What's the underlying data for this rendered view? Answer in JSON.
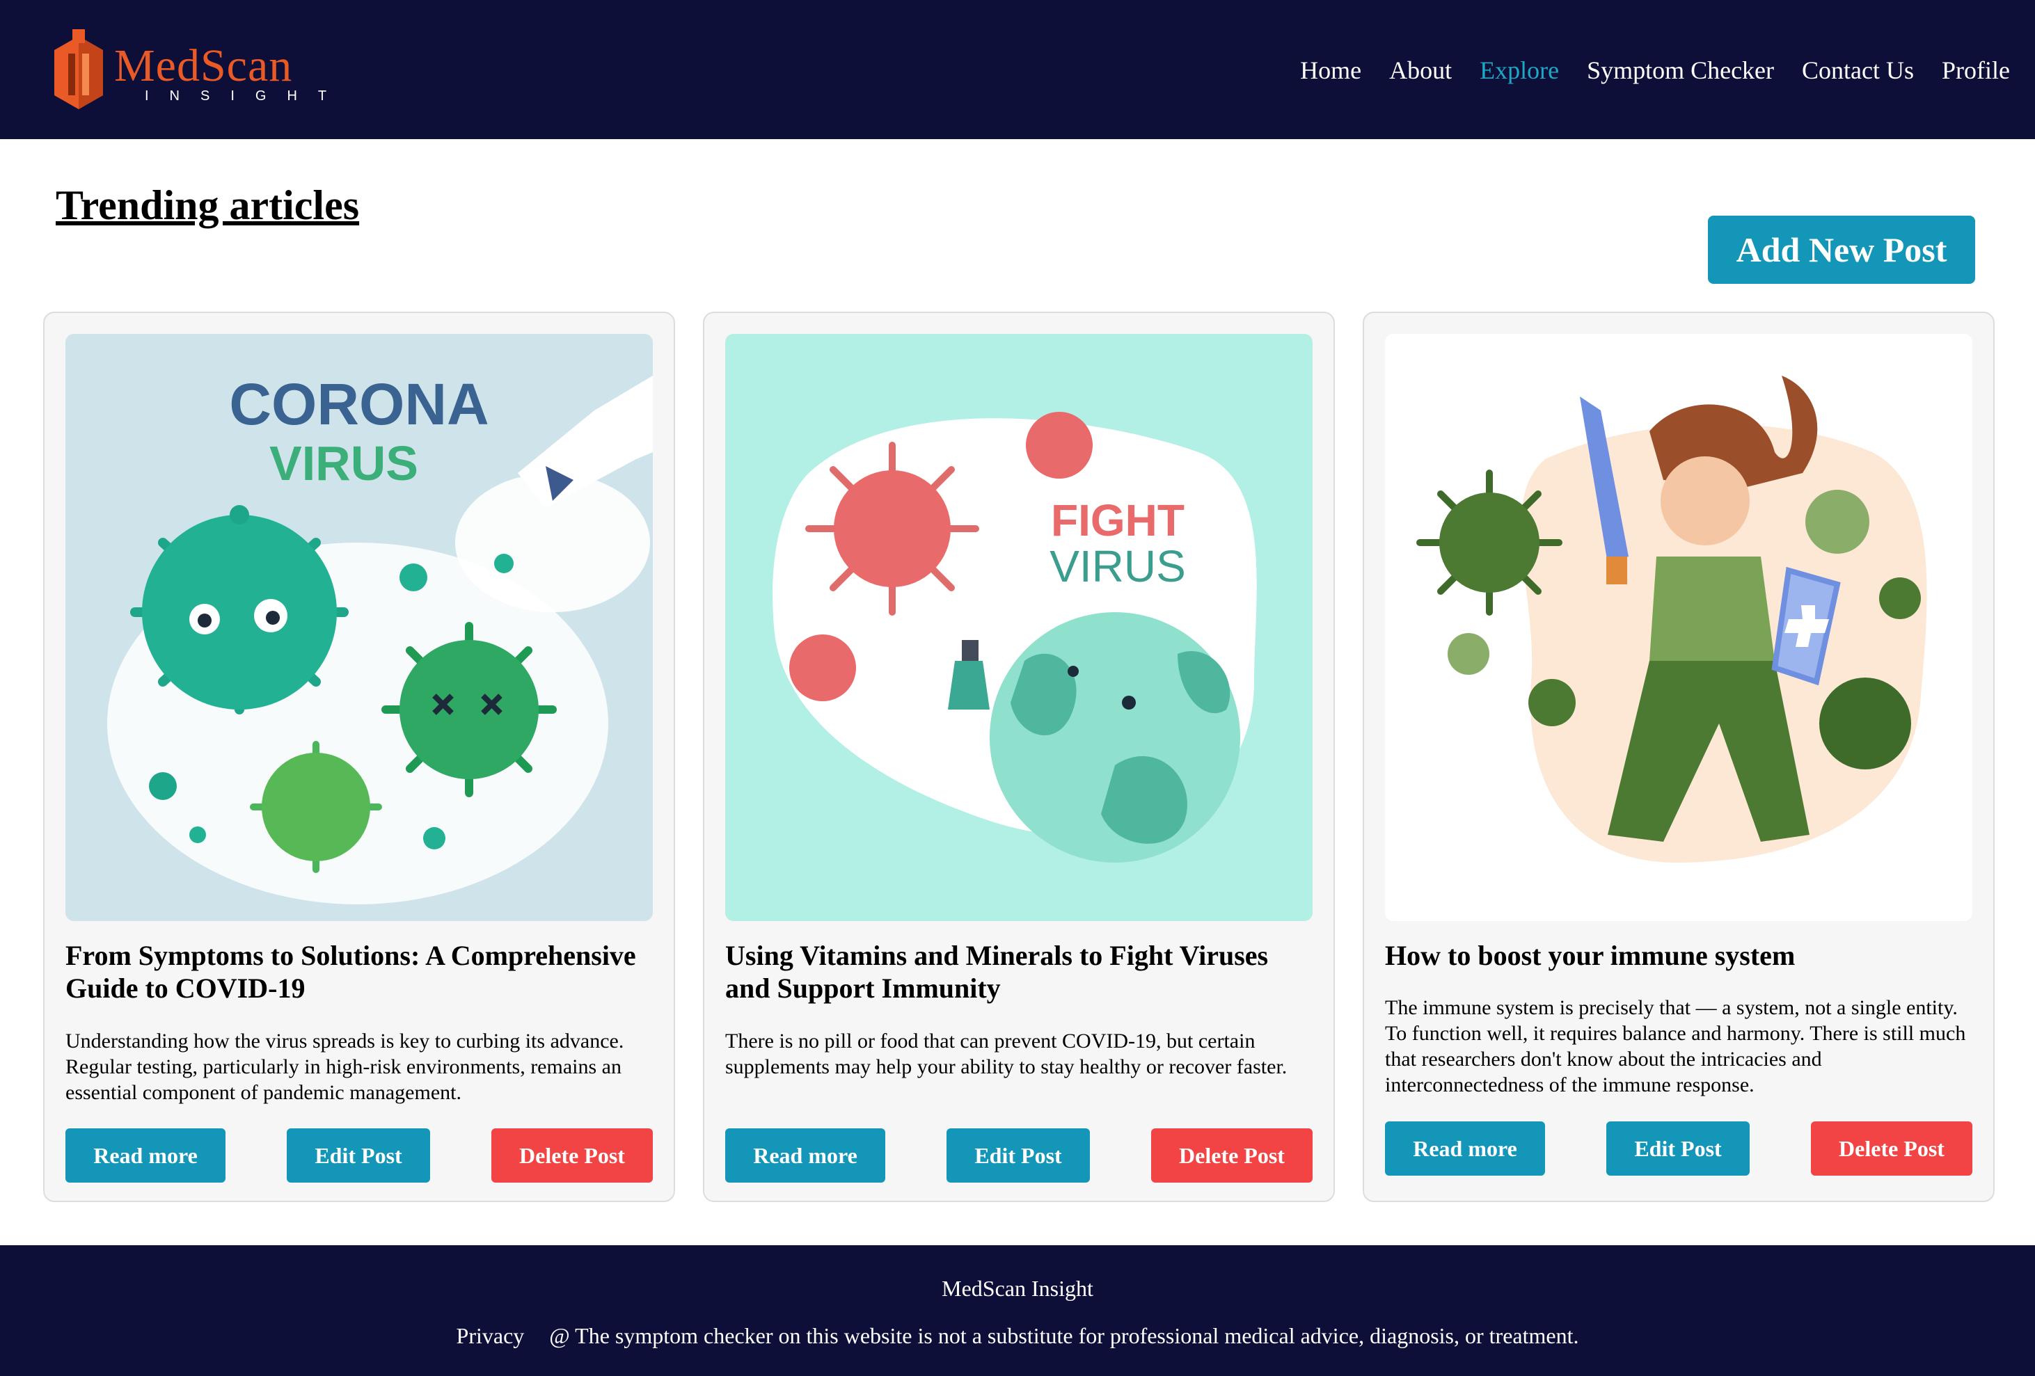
{
  "header": {
    "logo_main": "MedScan",
    "logo_sub": "INSIGHT",
    "nav": [
      "Home",
      "About",
      "Explore",
      "Symptom Checker",
      "Contact Us",
      "Profile"
    ],
    "active_nav": "Explore",
    "colors": {
      "background": "#0e0f38",
      "active": "#1fa7c4",
      "logo": "#ea5a26"
    }
  },
  "main": {
    "title": "Trending articles",
    "add_post_label": "Add New Post"
  },
  "cards": [
    {
      "image": "corona-virus-illustration",
      "image_text": [
        "CORONA",
        "VIRUS"
      ],
      "title": "From Symptoms to Solutions: A Comprehensive Guide to COVID-19",
      "description": "Understanding how the virus spreads is key to curbing its advance. Regular testing, particularly in high-risk environments, remains an essential component of pandemic management.",
      "read_more": "Read more",
      "edit": "Edit Post",
      "delete": "Delete Post"
    },
    {
      "image": "fight-virus-earth-illustration",
      "image_text": [
        "FIGHT",
        "VIRUS"
      ],
      "title": "Using Vitamins and Minerals to Fight Viruses and Support Immunity",
      "description": "There is no pill or food that can prevent COVID-19, but certain supplements may help your ability to stay healthy or recover faster.",
      "read_more": "Read more",
      "edit": "Edit Post",
      "delete": "Delete Post"
    },
    {
      "image": "woman-fighting-viruses-illustration",
      "title": "How to boost your immune system",
      "description": "The immune system is precisely that — a system, not a single entity. To function well, it requires balance and harmony. There is still much that researchers don't know about the intricacies and interconnectedness of the immune response.",
      "read_more": "Read more",
      "edit": "Edit Post",
      "delete": "Delete Post"
    }
  ],
  "footer": {
    "brand": "MedScan Insight",
    "privacy": "Privacy",
    "disclaimer": "@ The symptom checker on this website is not a substitute for professional medical advice, diagnosis, or treatment."
  }
}
